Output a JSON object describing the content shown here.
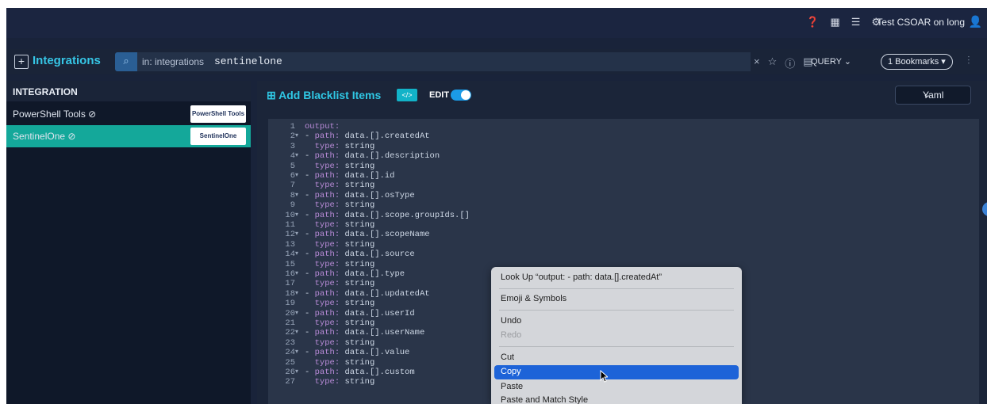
{
  "topbar": {
    "icons": [
      "help-icon",
      "apps-grid-icon",
      "database-icon",
      "settings-icon"
    ],
    "user_label": "Test CSOAR on long",
    "user_icon": "user-icon"
  },
  "searchbar": {
    "section_label": "Integrations",
    "scope": "in: integrations",
    "query": "sentinelone",
    "query_button": "QUERY",
    "bookmarks_label": "1 Bookmarks"
  },
  "sidebar": {
    "header": "INTEGRATION",
    "items": [
      {
        "name": "PowerShell Tools",
        "logo": "PowerShell Tools"
      },
      {
        "name": "SentinelOne",
        "logo": "SentinelOne"
      }
    ]
  },
  "main": {
    "title": "Add Blacklist Items",
    "code_badge": "</>",
    "edit_label": "EDIT",
    "format": "Yaml"
  },
  "editor": {
    "lines": [
      {
        "n": "1",
        "fold": "",
        "key": "output",
        "indent": "",
        "dash": false,
        "value": ""
      },
      {
        "n": "2",
        "fold": "▾",
        "key": "path",
        "indent": "",
        "dash": true,
        "value": "data.[].createdAt"
      },
      {
        "n": "3",
        "fold": "",
        "key": "type",
        "indent": "  ",
        "dash": false,
        "value": "string"
      },
      {
        "n": "4",
        "fold": "▾",
        "key": "path",
        "indent": "",
        "dash": true,
        "value": "data.[].description"
      },
      {
        "n": "5",
        "fold": "",
        "key": "type",
        "indent": "  ",
        "dash": false,
        "value": "string"
      },
      {
        "n": "6",
        "fold": "▾",
        "key": "path",
        "indent": "",
        "dash": true,
        "value": "data.[].id"
      },
      {
        "n": "7",
        "fold": "",
        "key": "type",
        "indent": "  ",
        "dash": false,
        "value": "string"
      },
      {
        "n": "8",
        "fold": "▾",
        "key": "path",
        "indent": "",
        "dash": true,
        "value": "data.[].osType"
      },
      {
        "n": "9",
        "fold": "",
        "key": "type",
        "indent": "  ",
        "dash": false,
        "value": "string"
      },
      {
        "n": "10",
        "fold": "▾",
        "key": "path",
        "indent": "",
        "dash": true,
        "value": "data.[].scope.groupIds.[]"
      },
      {
        "n": "11",
        "fold": "",
        "key": "type",
        "indent": "  ",
        "dash": false,
        "value": "string"
      },
      {
        "n": "12",
        "fold": "▾",
        "key": "path",
        "indent": "",
        "dash": true,
        "value": "data.[].scopeName"
      },
      {
        "n": "13",
        "fold": "",
        "key": "type",
        "indent": "  ",
        "dash": false,
        "value": "string"
      },
      {
        "n": "14",
        "fold": "▾",
        "key": "path",
        "indent": "",
        "dash": true,
        "value": "data.[].source"
      },
      {
        "n": "15",
        "fold": "",
        "key": "type",
        "indent": "  ",
        "dash": false,
        "value": "string"
      },
      {
        "n": "16",
        "fold": "▾",
        "key": "path",
        "indent": "",
        "dash": true,
        "value": "data.[].type"
      },
      {
        "n": "17",
        "fold": "",
        "key": "type",
        "indent": "  ",
        "dash": false,
        "value": "string"
      },
      {
        "n": "18",
        "fold": "▾",
        "key": "path",
        "indent": "",
        "dash": true,
        "value": "data.[].updatedAt"
      },
      {
        "n": "19",
        "fold": "",
        "key": "type",
        "indent": "  ",
        "dash": false,
        "value": "string"
      },
      {
        "n": "20",
        "fold": "▾",
        "key": "path",
        "indent": "",
        "dash": true,
        "value": "data.[].userId"
      },
      {
        "n": "21",
        "fold": "",
        "key": "type",
        "indent": "  ",
        "dash": false,
        "value": "string"
      },
      {
        "n": "22",
        "fold": "▾",
        "key": "path",
        "indent": "",
        "dash": true,
        "value": "data.[].userName"
      },
      {
        "n": "23",
        "fold": "",
        "key": "type",
        "indent": "  ",
        "dash": false,
        "value": "string"
      },
      {
        "n": "24",
        "fold": "▾",
        "key": "path",
        "indent": "",
        "dash": true,
        "value": "data.[].value"
      },
      {
        "n": "25",
        "fold": "",
        "key": "type",
        "indent": "  ",
        "dash": false,
        "value": "string"
      },
      {
        "n": "26",
        "fold": "▾",
        "key": "path",
        "indent": "",
        "dash": true,
        "value": "data.[].custom"
      },
      {
        "n": "27",
        "fold": "",
        "key": "type",
        "indent": "  ",
        "dash": false,
        "value": "string"
      }
    ]
  },
  "context_menu": {
    "items": [
      {
        "label": "Look Up “output: - path: data.[].createdAt”",
        "state": "normal"
      },
      {
        "label": "Emoji & Symbols",
        "state": "normal"
      },
      {
        "label": "Undo",
        "state": "normal"
      },
      {
        "label": "Redo",
        "state": "disabled"
      },
      {
        "label": "Cut",
        "state": "normal"
      },
      {
        "label": "Copy",
        "state": "selected"
      },
      {
        "label": "Paste",
        "state": "normal"
      },
      {
        "label": "Paste and Match Style",
        "state": "normal"
      }
    ]
  },
  "colors": {
    "accent": "#36c6e6",
    "active_row": "#14a89a",
    "menu_selection": "#1d63d8",
    "yaml_key": "#b98bd8"
  }
}
